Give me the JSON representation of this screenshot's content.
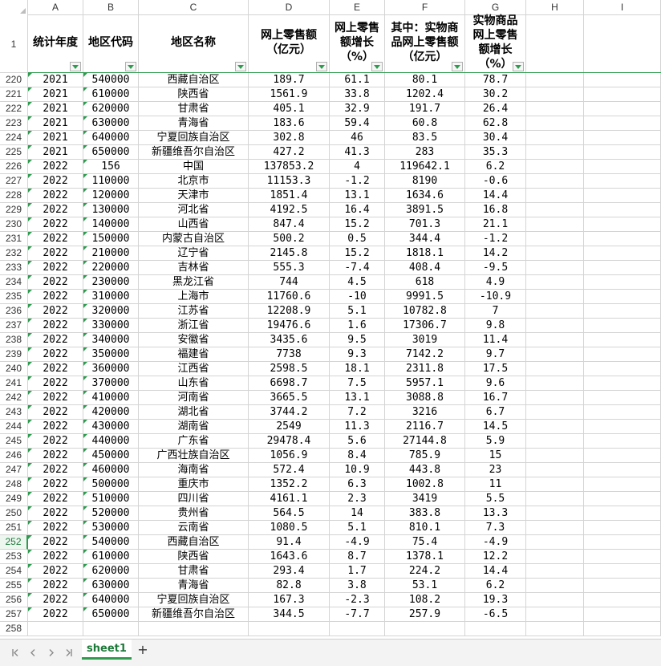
{
  "sheet": {
    "columns": [
      "A",
      "B",
      "C",
      "D",
      "E",
      "F",
      "G",
      "H",
      "I"
    ],
    "headers": [
      "统计年度",
      "地区代码",
      "地区名称",
      "网上零售额\n（亿元）",
      "网上零售\n额增长\n（%）",
      "其中：实物商\n品网上零售额\n（亿元）",
      "实物商品\n网上零售\n额增长\n（%）"
    ],
    "header_row_number": "1",
    "active_row": "252",
    "rows": [
      {
        "n": "220",
        "cells": [
          "2021",
          "540000",
          "西藏自治区",
          "189.7",
          "61.1",
          "80.1",
          "78.7"
        ]
      },
      {
        "n": "221",
        "cells": [
          "2021",
          "610000",
          "陕西省",
          "1561.9",
          "33.8",
          "1202.4",
          "30.2"
        ]
      },
      {
        "n": "222",
        "cells": [
          "2021",
          "620000",
          "甘肃省",
          "405.1",
          "32.9",
          "191.7",
          "26.4"
        ]
      },
      {
        "n": "223",
        "cells": [
          "2021",
          "630000",
          "青海省",
          "183.6",
          "59.4",
          "60.8",
          "62.8"
        ]
      },
      {
        "n": "224",
        "cells": [
          "2021",
          "640000",
          "宁夏回族自治区",
          "302.8",
          "46",
          "83.5",
          "30.4"
        ]
      },
      {
        "n": "225",
        "cells": [
          "2021",
          "650000",
          "新疆维吾尔自治区",
          "427.2",
          "41.3",
          "283",
          "35.3"
        ]
      },
      {
        "n": "226",
        "cells": [
          "2022",
          "156",
          "中国",
          "137853.2",
          "4",
          "119642.1",
          "6.2"
        ]
      },
      {
        "n": "227",
        "cells": [
          "2022",
          "110000",
          "北京市",
          "11153.3",
          "-1.2",
          "8190",
          "-0.6"
        ]
      },
      {
        "n": "228",
        "cells": [
          "2022",
          "120000",
          "天津市",
          "1851.4",
          "13.1",
          "1634.6",
          "14.4"
        ]
      },
      {
        "n": "229",
        "cells": [
          "2022",
          "130000",
          "河北省",
          "4192.5",
          "16.4",
          "3891.5",
          "16.8"
        ]
      },
      {
        "n": "230",
        "cells": [
          "2022",
          "140000",
          "山西省",
          "847.4",
          "15.2",
          "701.3",
          "21.1"
        ]
      },
      {
        "n": "231",
        "cells": [
          "2022",
          "150000",
          "内蒙古自治区",
          "500.2",
          "0.5",
          "344.4",
          "-1.2"
        ]
      },
      {
        "n": "232",
        "cells": [
          "2022",
          "210000",
          "辽宁省",
          "2145.8",
          "15.2",
          "1818.1",
          "14.2"
        ]
      },
      {
        "n": "233",
        "cells": [
          "2022",
          "220000",
          "吉林省",
          "555.3",
          "-7.4",
          "408.4",
          "-9.5"
        ]
      },
      {
        "n": "234",
        "cells": [
          "2022",
          "230000",
          "黑龙江省",
          "744",
          "4.5",
          "618",
          "4.9"
        ]
      },
      {
        "n": "235",
        "cells": [
          "2022",
          "310000",
          "上海市",
          "11760.6",
          "-10",
          "9991.5",
          "-10.9"
        ]
      },
      {
        "n": "236",
        "cells": [
          "2022",
          "320000",
          "江苏省",
          "12208.9",
          "5.1",
          "10782.8",
          "7"
        ]
      },
      {
        "n": "237",
        "cells": [
          "2022",
          "330000",
          "浙江省",
          "19476.6",
          "1.6",
          "17306.7",
          "9.8"
        ]
      },
      {
        "n": "238",
        "cells": [
          "2022",
          "340000",
          "安徽省",
          "3435.6",
          "9.5",
          "3019",
          "11.4"
        ]
      },
      {
        "n": "239",
        "cells": [
          "2022",
          "350000",
          "福建省",
          "7738",
          "9.3",
          "7142.2",
          "9.7"
        ]
      },
      {
        "n": "240",
        "cells": [
          "2022",
          "360000",
          "江西省",
          "2598.5",
          "18.1",
          "2311.8",
          "17.5"
        ]
      },
      {
        "n": "241",
        "cells": [
          "2022",
          "370000",
          "山东省",
          "6698.7",
          "7.5",
          "5957.1",
          "9.6"
        ]
      },
      {
        "n": "242",
        "cells": [
          "2022",
          "410000",
          "河南省",
          "3665.5",
          "13.1",
          "3088.8",
          "16.7"
        ]
      },
      {
        "n": "243",
        "cells": [
          "2022",
          "420000",
          "湖北省",
          "3744.2",
          "7.2",
          "3216",
          "6.7"
        ]
      },
      {
        "n": "244",
        "cells": [
          "2022",
          "430000",
          "湖南省",
          "2549",
          "11.3",
          "2116.7",
          "14.5"
        ]
      },
      {
        "n": "245",
        "cells": [
          "2022",
          "440000",
          "广东省",
          "29478.4",
          "5.6",
          "27144.8",
          "5.9"
        ]
      },
      {
        "n": "246",
        "cells": [
          "2022",
          "450000",
          "广西壮族自治区",
          "1056.9",
          "8.4",
          "785.9",
          "15"
        ]
      },
      {
        "n": "247",
        "cells": [
          "2022",
          "460000",
          "海南省",
          "572.4",
          "10.9",
          "443.8",
          "23"
        ]
      },
      {
        "n": "248",
        "cells": [
          "2022",
          "500000",
          "重庆市",
          "1352.2",
          "6.3",
          "1002.8",
          "11"
        ]
      },
      {
        "n": "249",
        "cells": [
          "2022",
          "510000",
          "四川省",
          "4161.1",
          "2.3",
          "3419",
          "5.5"
        ]
      },
      {
        "n": "250",
        "cells": [
          "2022",
          "520000",
          "贵州省",
          "564.5",
          "14",
          "383.8",
          "13.3"
        ]
      },
      {
        "n": "251",
        "cells": [
          "2022",
          "530000",
          "云南省",
          "1080.5",
          "5.1",
          "810.1",
          "7.3"
        ]
      },
      {
        "n": "252",
        "cells": [
          "2022",
          "540000",
          "西藏自治区",
          "91.4",
          "-4.9",
          "75.4",
          "-4.9"
        ]
      },
      {
        "n": "253",
        "cells": [
          "2022",
          "610000",
          "陕西省",
          "1643.6",
          "8.7",
          "1378.1",
          "12.2"
        ]
      },
      {
        "n": "254",
        "cells": [
          "2022",
          "620000",
          "甘肃省",
          "293.4",
          "1.7",
          "224.2",
          "14.4"
        ]
      },
      {
        "n": "255",
        "cells": [
          "2022",
          "630000",
          "青海省",
          "82.8",
          "3.8",
          "53.1",
          "6.2"
        ]
      },
      {
        "n": "256",
        "cells": [
          "2022",
          "640000",
          "宁夏回族自治区",
          "167.3",
          "-2.3",
          "108.2",
          "19.3"
        ]
      },
      {
        "n": "257",
        "cells": [
          "2022",
          "650000",
          "新疆维吾尔自治区",
          "344.5",
          "-7.7",
          "257.9",
          "-6.5"
        ]
      },
      {
        "n": "258",
        "cells": [
          "",
          "",
          "",
          "",
          "",
          "",
          ""
        ]
      }
    ]
  },
  "tabs": {
    "sheets": [
      "sheet1"
    ],
    "active": "sheet1",
    "add_label": "+",
    "nav_icons": [
      "first-sheet-icon",
      "prev-sheet-icon",
      "next-sheet-icon",
      "last-sheet-icon"
    ]
  },
  "colors": {
    "accent": "#2e9b4f",
    "gridline": "#d4d4d4",
    "tabbar": "#f3f3f3"
  }
}
